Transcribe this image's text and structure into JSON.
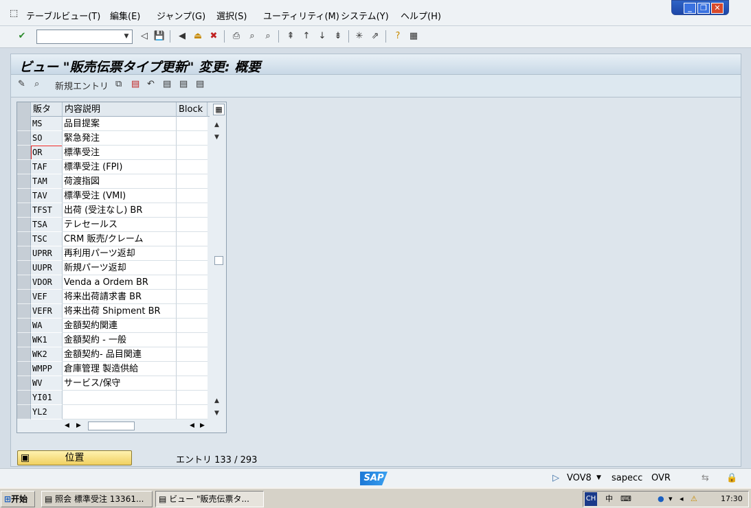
{
  "menu": {
    "items": [
      "テーブルビュー(T)",
      "編集(E)",
      "ジャンプ(G)",
      "選択(S)",
      "ユーティリティ(M)",
      "システム(Y)",
      "ヘルプ(H)"
    ]
  },
  "window_controls": {
    "minimize": "_",
    "restore": "❐",
    "close": "✕"
  },
  "toolbar": {
    "command_field_value": ""
  },
  "title": "ビュー \"販売伝票タイプ更新\" 変更: 概要",
  "app_toolbar": {
    "new_entries_label": "新規エントリ"
  },
  "table": {
    "headers": [
      "販タ",
      "内容説明",
      "Block"
    ],
    "rows": [
      {
        "code": "MS",
        "desc": "品目提案"
      },
      {
        "code": "SO",
        "desc": "緊急発注"
      },
      {
        "code": "OR",
        "desc": "標準受注"
      },
      {
        "code": "TAF",
        "desc": "標準受注 (FPI)"
      },
      {
        "code": "TAM",
        "desc": "荷渡指図"
      },
      {
        "code": "TAV",
        "desc": "標準受注 (VMI)"
      },
      {
        "code": "TFST",
        "desc": "出荷 (受注なし) BR"
      },
      {
        "code": "TSA",
        "desc": "テレセールス"
      },
      {
        "code": "TSC",
        "desc": "CRM 販売/クレーム"
      },
      {
        "code": "UPRR",
        "desc": "再利用パーツ返却"
      },
      {
        "code": "UUPR",
        "desc": "新規パーツ返却"
      },
      {
        "code": "VDOR",
        "desc": "Venda a Ordem BR"
      },
      {
        "code": "VEF",
        "desc": "将来出荷請求書 BR"
      },
      {
        "code": "VEFR",
        "desc": "将来出荷 Shipment BR"
      },
      {
        "code": "WA",
        "desc": "金額契約関連"
      },
      {
        "code": "WK1",
        "desc": "金額契約 - 一般"
      },
      {
        "code": "WK2",
        "desc": "金額契約- 品目関連"
      },
      {
        "code": "WMPP",
        "desc": "倉庫管理 製造供給"
      },
      {
        "code": "WV",
        "desc": "サービス/保守"
      },
      {
        "code": "YI01",
        "desc": ""
      },
      {
        "code": "YL2",
        "desc": ""
      }
    ]
  },
  "position_button": "位置",
  "entry_counter": "エントリ 133 / 293",
  "status": {
    "sap_logo": "SAP",
    "transaction": "VOV8",
    "server": "sapecc",
    "mode": "OVR"
  },
  "taskbar": {
    "start": "开始",
    "tasks": [
      "照会 標準受注 13361...",
      "ビュー \"販売伝票タ..."
    ],
    "tray_lang": "CH",
    "tray_text": "中",
    "clock": "17:30"
  },
  "colors": {
    "accent": "#f0d060",
    "title_bg": "#c8d8e6",
    "sap_blue": "#1c78d6"
  }
}
